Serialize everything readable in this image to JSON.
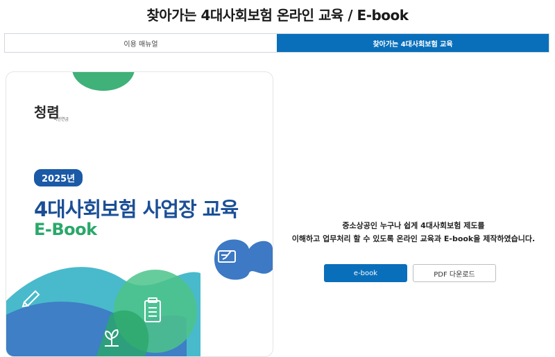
{
  "header": {
    "title": "찾아가는 4대사회보험 온라인 교육 / E-book"
  },
  "tabs": [
    {
      "label": "이용 매뉴얼",
      "active": false
    },
    {
      "label": "찾아가는 4대사회보험 교육",
      "active": true
    }
  ],
  "cover": {
    "brand": "청렴",
    "brand_sub": "국민연금",
    "year": "2025년",
    "title": "4대사회보험 사업장 교육",
    "subtitle": "E-Book",
    "icons": [
      "check-card-icon",
      "pencil-icon",
      "clipboard-icon",
      "sprout-icon"
    ]
  },
  "description": {
    "line1": "중소상공인 누구나 쉽게 4대사회보험 제도를",
    "line2": "이해하고 업무처리 할 수 있도록 온라인 교육과 E-book을 제작하였습니다."
  },
  "actions": {
    "ebook_label": "e-book",
    "pdf_label": "PDF 다운로드"
  },
  "colors": {
    "accent": "#0a6fba",
    "cover_blue": "#1b4f97",
    "cover_green": "#2aa86a",
    "teal": "#3fb6c8",
    "mint": "#4cc38a"
  }
}
